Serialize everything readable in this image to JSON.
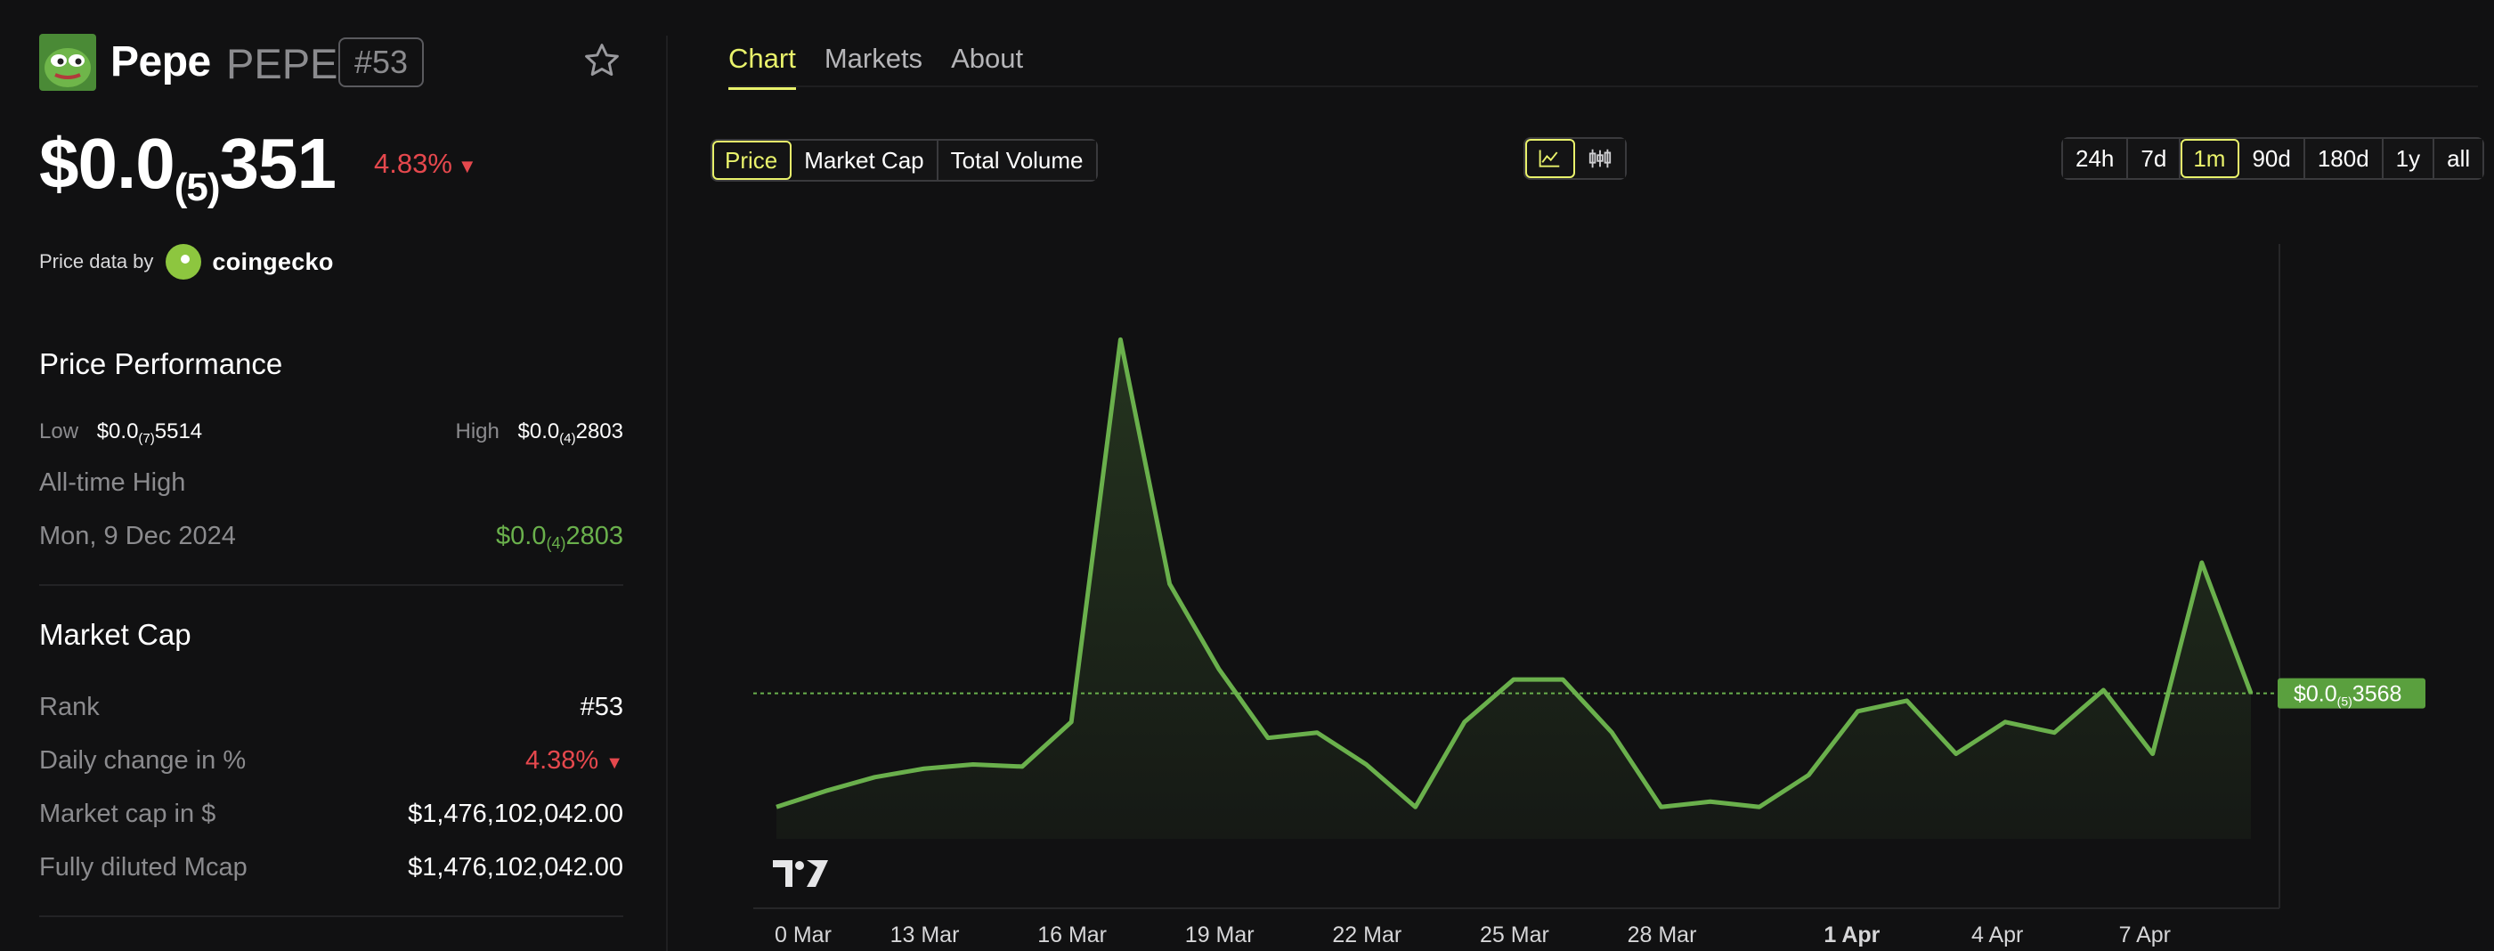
{
  "coin": {
    "name": "Pepe",
    "symbol": "PEPE",
    "rank_badge": "#53",
    "price_main": "$0.0",
    "price_sub": "(5)",
    "price_tail": "351",
    "change_pct": "4.83%",
    "change_arrow": "▼"
  },
  "price_data_by": {
    "label": "Price data by",
    "provider": "coingecko"
  },
  "performance": {
    "title": "Price Performance",
    "low_label": "Low",
    "low_main": "$0.0",
    "low_sub": "(7)",
    "low_tail": "5514",
    "high_label": "High",
    "high_main": "$0.0",
    "high_sub": "(4)",
    "high_tail": "2803",
    "ath_label": "All-time High",
    "ath_date": "Mon, 9 Dec 2024",
    "ath_main": "$0.0",
    "ath_sub": "(4)",
    "ath_tail": "2803"
  },
  "market_cap": {
    "title": "Market Cap",
    "rows": [
      {
        "label": "Rank",
        "value": "#53"
      },
      {
        "label": "Daily change in %",
        "value": "4.38%",
        "arrow": "▼"
      },
      {
        "label": "Market cap in $",
        "value": "$1,476,102,042.00"
      },
      {
        "label": "Fully diluted Mcap",
        "value": "$1,476,102,042.00"
      }
    ]
  },
  "tabs": [
    "Chart",
    "Markets",
    "About"
  ],
  "metric_buttons": [
    "Price",
    "Market Cap",
    "Total Volume"
  ],
  "range_buttons": [
    "24h",
    "7d",
    "1m",
    "90d",
    "180d",
    "1y",
    "all"
  ],
  "active_range": "1m",
  "icons": {
    "line": "line-chart-icon",
    "candle": "candlestick-icon",
    "star": "star-icon"
  },
  "colors": {
    "accent": "#e9f26b",
    "line": "#6ab04c",
    "down": "#e5484d"
  },
  "chart_data": {
    "type": "area",
    "x_tick_labels": [
      "0 Mar",
      "13 Mar",
      "16 Mar",
      "19 Mar",
      "22 Mar",
      "25 Mar",
      "28 Mar",
      "1 Apr",
      "4 Apr",
      "7 Apr"
    ],
    "x_tick_positions": [
      0,
      3,
      6,
      9,
      12,
      15,
      18,
      22,
      25,
      28
    ],
    "values": [
      2.5e-06,
      2.65e-06,
      2.78e-06,
      2.86e-06,
      2.9e-06,
      2.88e-06,
      3.3e-06,
      6.9e-06,
      4.6e-06,
      3.8e-06,
      3.15e-06,
      3.2e-06,
      2.9e-06,
      2.5e-06,
      3.3e-06,
      3.7e-06,
      3.7e-06,
      3.2e-06,
      2.5e-06,
      2.55e-06,
      2.5e-06,
      2.8e-06,
      3.4e-06,
      3.5e-06,
      3e-06,
      3.3e-06,
      3.2e-06,
      3.6e-06,
      3e-06,
      4.8e-06,
      3.57e-06
    ],
    "current_label_main": "$0.0",
    "current_label_sub": "(5)",
    "current_label_tail": "3568",
    "current_value": 3.57e-06,
    "ylim": [
      2.2e-06,
      7.8e-06
    ]
  }
}
